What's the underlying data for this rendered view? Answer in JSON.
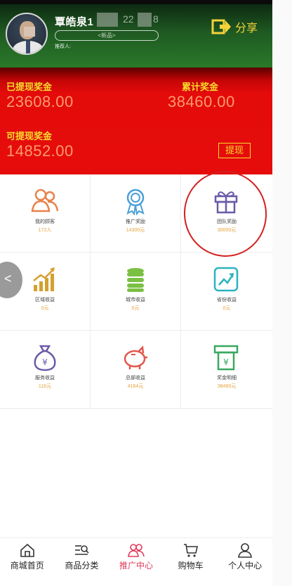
{
  "header": {
    "user_name": "覃皓泉1",
    "phone_partial_2": "22",
    "phone_partial_8": "8",
    "level_badge": "<新品>",
    "referrer": "推荐人:",
    "share_label": "分享"
  },
  "banner": {
    "withdrawn_label": "已提现奖金",
    "withdrawn_value": "23608.00",
    "total_label": "累计奖金",
    "total_value": "38460.00",
    "available_label": "可提现奖金",
    "available_value": "14852.00",
    "withdraw_button": "提现"
  },
  "grid": [
    {
      "title": "我的顾客",
      "value": "172人",
      "icon": "people-icon",
      "color": "#e8824a"
    },
    {
      "title": "推广奖励",
      "value": "14300元",
      "icon": "award-icon",
      "color": "#4a9fd6"
    },
    {
      "title": "团队奖励",
      "value": "30000元",
      "icon": "gift-icon",
      "color": "#6a5aa8"
    },
    {
      "title": "区域收益",
      "value": "0元",
      "icon": "growth-chart-icon",
      "color": "#d4a030"
    },
    {
      "title": "城市收益",
      "value": "0元",
      "icon": "coins-icon",
      "color": "#7bc043"
    },
    {
      "title": "省份收益",
      "value": "0元",
      "icon": "trend-icon",
      "color": "#2bb3c0"
    },
    {
      "title": "服务收益",
      "value": "116元",
      "icon": "money-bag-icon",
      "color": "#6a5aa8"
    },
    {
      "title": "总部收益",
      "value": "4164元",
      "icon": "piggy-bank-icon",
      "color": "#e2574c"
    },
    {
      "title": "奖金明细",
      "value": "38460元",
      "icon": "receipt-icon",
      "color": "#3aa860"
    }
  ],
  "nav": [
    {
      "label": "商城首页",
      "icon": "home-icon",
      "active": false
    },
    {
      "label": "商品分类",
      "icon": "category-search-icon",
      "active": false
    },
    {
      "label": "推广中心",
      "icon": "promotion-icon",
      "active": true
    },
    {
      "label": "购物车",
      "icon": "cart-icon",
      "active": false
    },
    {
      "label": "个人中心",
      "icon": "person-icon",
      "active": false
    }
  ],
  "back_button_glyph": "<",
  "colors": {
    "header_green": "#1f5a22",
    "banner_red": "#e60c0c",
    "label_yellow": "#f7dd2b",
    "value_orange": "#ff9a6a",
    "active_nav": "#e23a5a"
  }
}
